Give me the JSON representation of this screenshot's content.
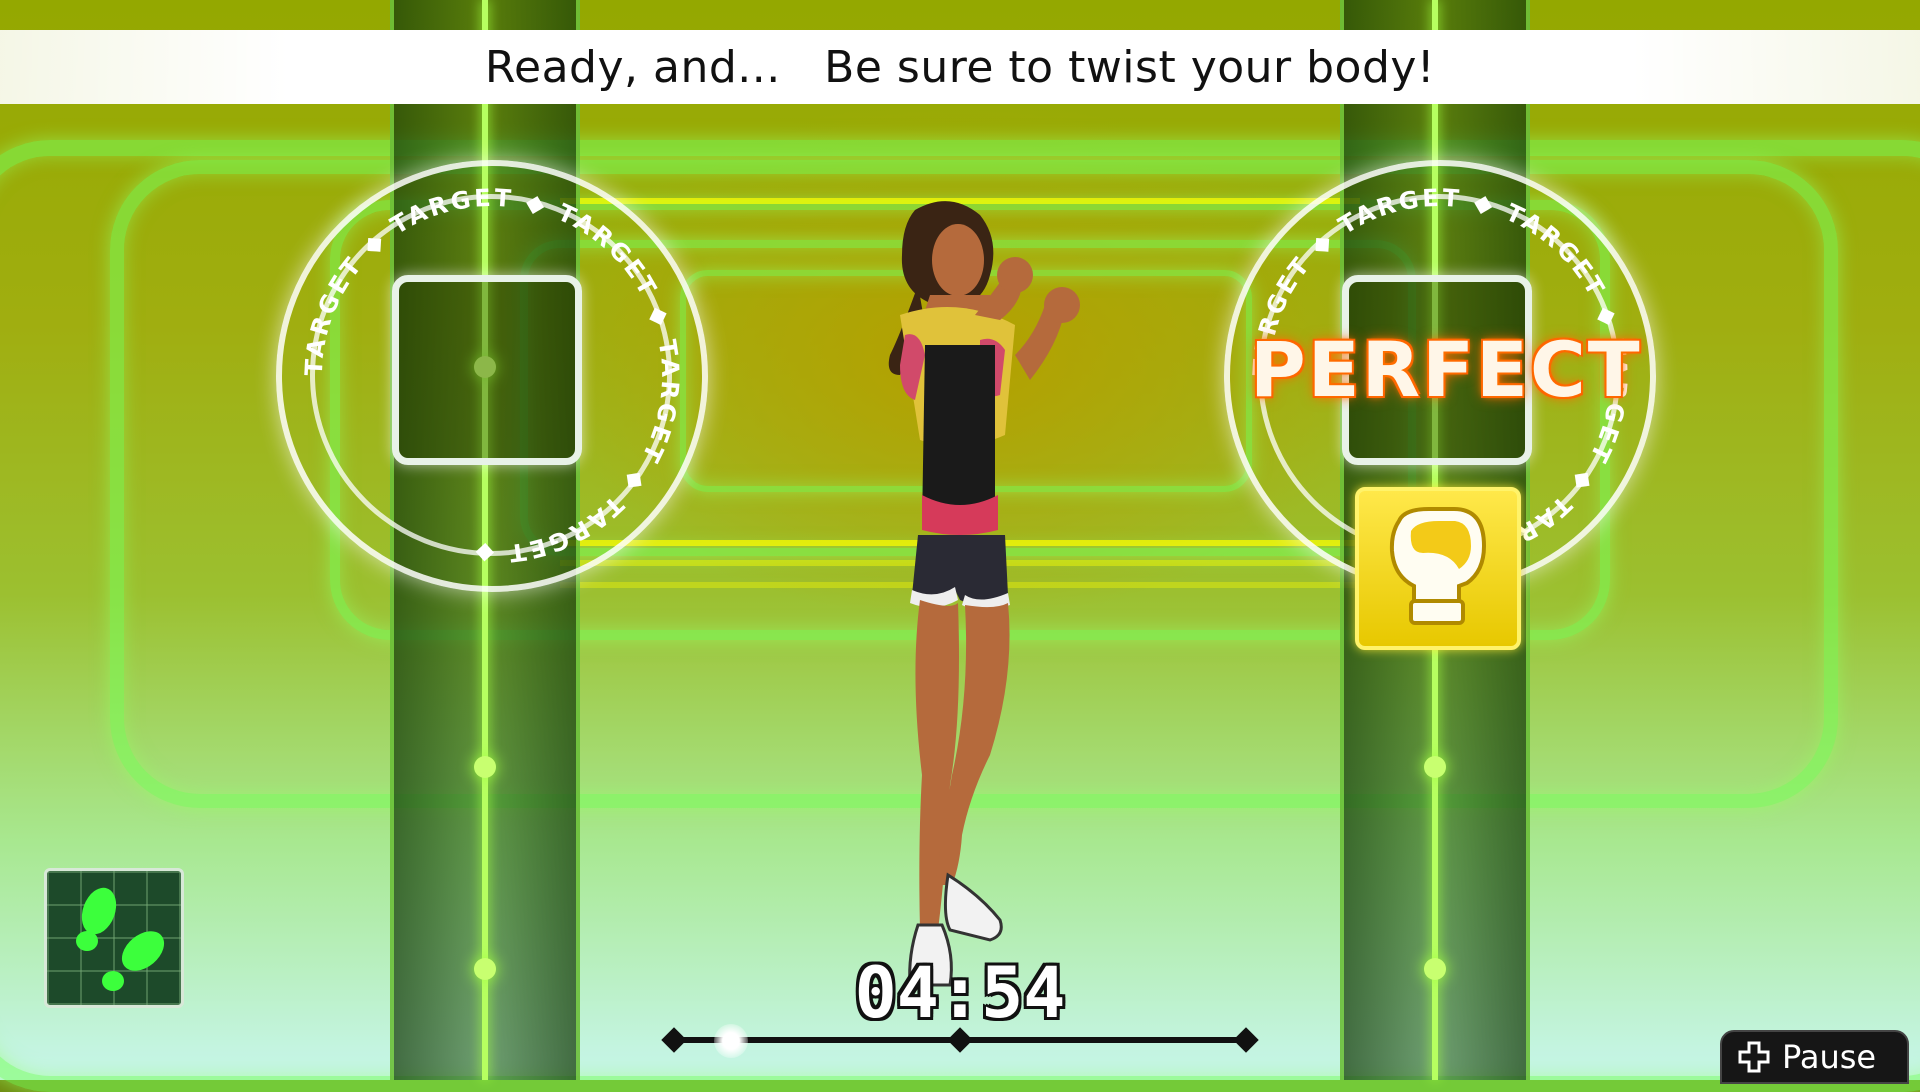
{
  "instruction": {
    "text": "Ready, and...   Be sure to twist your body!"
  },
  "targets": {
    "left": {
      "ring_label": "TARGET"
    },
    "right": {
      "ring_label": "TARGET",
      "feedback": "PERFECT"
    }
  },
  "next_move": {
    "icon": "boxing-glove-icon"
  },
  "step_indicator": {
    "icon": "footsteps-icon"
  },
  "timer": {
    "text": "04:54"
  },
  "progress": {
    "knob_position": 0.1,
    "markers": 3
  },
  "pause_button": {
    "label": "Pause",
    "icon": "plus-button-icon"
  },
  "colors": {
    "accent_green": "#8cff50",
    "feedback_orange": "#ff6a00",
    "card_yellow": "#ffd800"
  }
}
